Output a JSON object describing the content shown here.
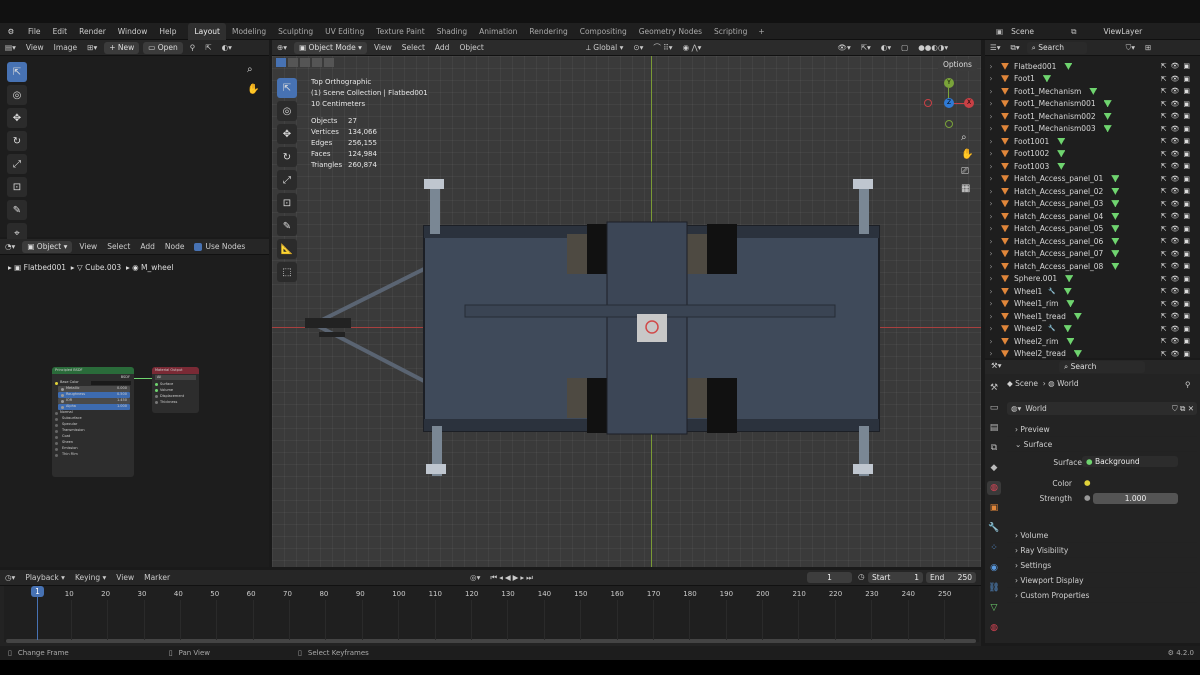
{
  "menu": {
    "items": [
      "File",
      "Edit",
      "Render",
      "Window",
      "Help"
    ]
  },
  "workspaces": [
    "Layout",
    "Modeling",
    "Sculpting",
    "UV Editing",
    "Texture Paint",
    "Shading",
    "Animation",
    "Rendering",
    "Compositing",
    "Geometry Nodes",
    "Scripting"
  ],
  "scene": "Scene",
  "viewlayer": "ViewLayer",
  "image_editor": {
    "view": "View",
    "image": "Image",
    "new": "New",
    "open": "Open"
  },
  "node_editor": {
    "object": "Object",
    "view": "View",
    "select": "Select",
    "add": "Add",
    "node": "Node",
    "use_nodes": "Use Nodes",
    "breadcrumb": [
      "Flatbed001",
      "Cube.003",
      "M_wheel"
    ]
  },
  "bsdf": {
    "title": "Principled BSDF",
    "out": "BSDF",
    "rows": [
      "Base Color",
      "Metallic",
      "Roughness",
      "IOR",
      "Alpha",
      "Normal",
      "Subsurface",
      "Specular",
      "Transmission",
      "Coat",
      "Sheen",
      "Emission",
      "Thin Film"
    ],
    "vals": [
      "",
      "0.000",
      "0.500",
      "1.450",
      "1.000"
    ]
  },
  "matout": {
    "title": "Material Output",
    "target": "All",
    "rows": [
      "Surface",
      "Volume",
      "Displacement",
      "Thickness"
    ]
  },
  "viewport": {
    "mode": "Object Mode",
    "view": "View",
    "select": "Select",
    "add": "Add",
    "object": "Object",
    "orientation": "Global",
    "options": "Options",
    "overlay": [
      "Top Orthographic",
      "(1) Scene Collection | Flatbed001",
      "10 Centimeters"
    ],
    "stats": [
      [
        "Objects",
        "27"
      ],
      [
        "Vertices",
        "134,066"
      ],
      [
        "Edges",
        "256,155"
      ],
      [
        "Faces",
        "124,984"
      ],
      [
        "Triangles",
        "260,874"
      ]
    ],
    "axes": {
      "x": "X",
      "y": "Y",
      "z": "Z"
    }
  },
  "outliner": {
    "search": "Search",
    "items": [
      "Flatbed001",
      "Foot1",
      "Foot1_Mechanism",
      "Foot1_Mechanism001",
      "Foot1_Mechanism002",
      "Foot1_Mechanism003",
      "Foot1001",
      "Foot1002",
      "Foot1003",
      "Hatch_Access_panel_01",
      "Hatch_Access_panel_02",
      "Hatch_Access_panel_03",
      "Hatch_Access_panel_04",
      "Hatch_Access_panel_05",
      "Hatch_Access_panel_06",
      "Hatch_Access_panel_07",
      "Hatch_Access_panel_08",
      "Sphere.001",
      "Wheel1",
      "Wheel1_rim",
      "Wheel1_tread",
      "Wheel2",
      "Wheel2_rim",
      "Wheel2_tread"
    ]
  },
  "props": {
    "search": "Search",
    "scene": "Scene",
    "world_bc": "World",
    "world": "World",
    "sections": [
      "Preview",
      "Surface",
      "Volume",
      "Ray Visibility",
      "Settings",
      "Viewport Display",
      "Custom Properties"
    ],
    "surface_label": "Surface",
    "surface_val": "Background",
    "color_label": "Color",
    "strength_label": "Strength",
    "strength_val": "1.000"
  },
  "timeline": {
    "playback": "Playback",
    "keying": "Keying",
    "view": "View",
    "marker": "Marker",
    "current": "1",
    "start_label": "Start",
    "start": "1",
    "end_label": "End",
    "end": "250",
    "ticks": [
      "1",
      "10",
      "20",
      "30",
      "40",
      "50",
      "60",
      "70",
      "80",
      "90",
      "100",
      "110",
      "120",
      "130",
      "140",
      "150",
      "160",
      "170",
      "180",
      "190",
      "200",
      "210",
      "220",
      "230",
      "240",
      "250"
    ]
  },
  "status": {
    "a": "Change Frame",
    "b": "Pan View",
    "c": "Select Keyframes",
    "version": "4.2.0"
  }
}
